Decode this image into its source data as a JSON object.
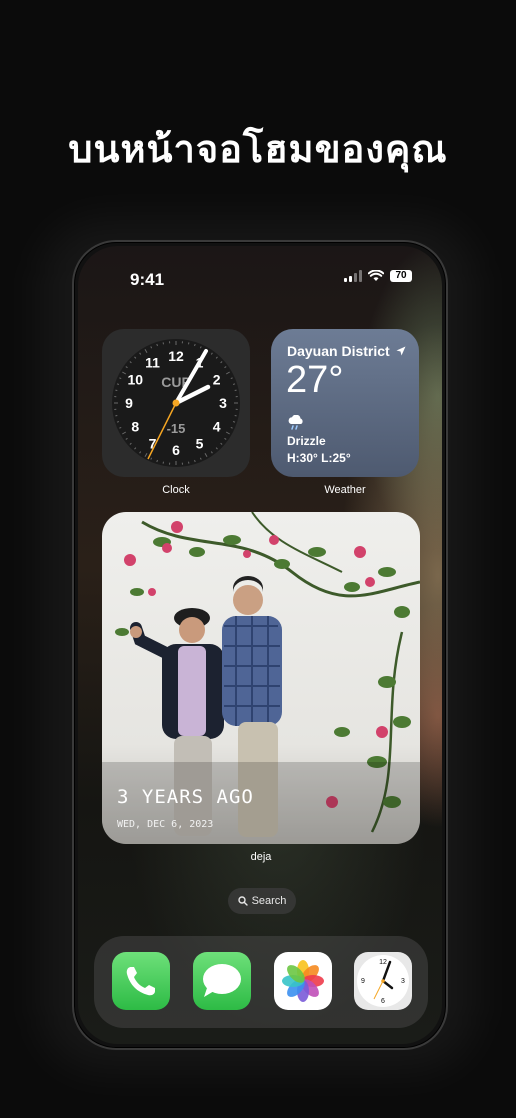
{
  "headline": "บนหน้าจอโฮมของคุณ",
  "status": {
    "time": "9:41",
    "battery": "70"
  },
  "clock_widget": {
    "label": "Clock",
    "city": "CUP",
    "offset": "-15",
    "numerals": [
      "12",
      "1",
      "2",
      "3",
      "4",
      "5",
      "6",
      "7",
      "8",
      "9",
      "10",
      "11"
    ]
  },
  "weather_widget": {
    "label": "Weather",
    "location": "Dayuan District",
    "temperature": "27°",
    "condition": "Drizzle",
    "high_low": "H:30° L:25°"
  },
  "photo_widget": {
    "label": "deja",
    "caption": "3 YEARS AGO",
    "date": "WED, DEC 6, 2023"
  },
  "search": {
    "label": "Search"
  },
  "dock": {
    "apps": [
      "phone-app",
      "messages-app",
      "photos-app",
      "clock-app"
    ]
  },
  "colors": {
    "weather_top": "#6d7c95",
    "phone_green": "#4cd964",
    "messages_green": "#34c759"
  }
}
